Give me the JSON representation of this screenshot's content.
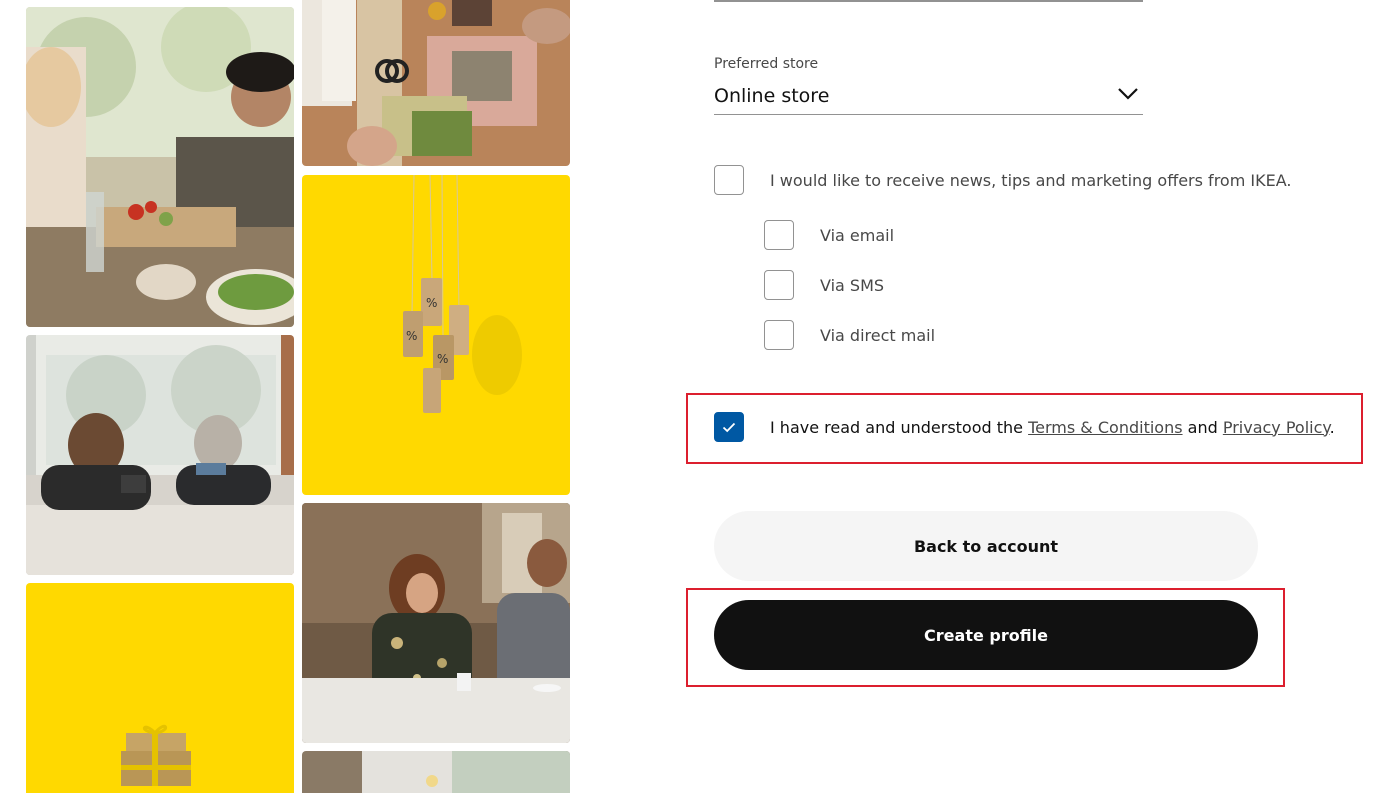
{
  "form": {
    "preferred_store_label": "Preferred store",
    "preferred_store_value": "Online store",
    "marketing_optin_label": "I would like to receive news, tips and marketing offers from IKEA.",
    "marketing_optin_checked": false,
    "channels": [
      {
        "label": "Via email",
        "checked": false
      },
      {
        "label": "Via SMS",
        "checked": false
      },
      {
        "label": "Via direct mail",
        "checked": false
      }
    ],
    "terms": {
      "prefix": "I have read and understood the ",
      "terms_link": "Terms & Conditions",
      "conjunction": " and ",
      "privacy_link": "Privacy Policy",
      "suffix": ".",
      "checked": true
    }
  },
  "buttons": {
    "back_label": "Back to account",
    "create_label": "Create profile"
  },
  "colors": {
    "brand_blue": "#0058a3",
    "brand_yellow": "#ffdb00",
    "highlight_red": "#dc1f2e",
    "primary_button": "#111111"
  }
}
